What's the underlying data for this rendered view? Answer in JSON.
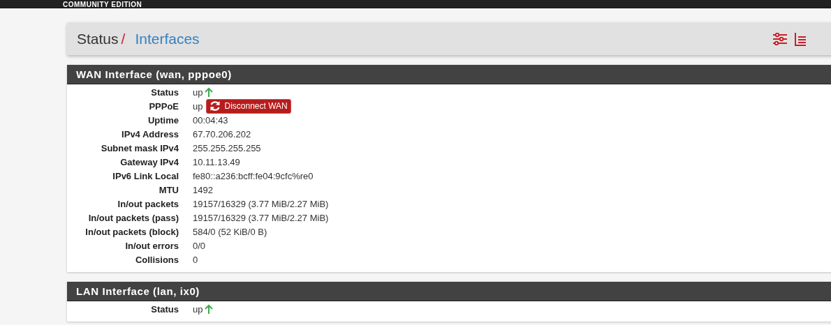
{
  "top_bar": {
    "edition": "COMMUNITY EDITION"
  },
  "breadcrumb": {
    "parent": "Status",
    "separator": "/",
    "current": "Interfaces"
  },
  "panels": [
    {
      "title": "WAN Interface (wan, pppoe0)",
      "rows": [
        {
          "label": "Status",
          "value": "up",
          "kind": "up"
        },
        {
          "label": "PPPoE",
          "value": "up",
          "kind": "action",
          "button": "Disconnect WAN"
        },
        {
          "label": "Uptime",
          "value": "00:04:43",
          "kind": "plain"
        },
        {
          "label": "IPv4 Address",
          "value": "67.70.206.202",
          "kind": "plain"
        },
        {
          "label": "Subnet mask IPv4",
          "value": "255.255.255.255",
          "kind": "plain"
        },
        {
          "label": "Gateway IPv4",
          "value": "10.11.13.49",
          "kind": "plain"
        },
        {
          "label": "IPv6 Link Local",
          "value": "fe80::a236:bcff:fe04:9cfc%re0",
          "kind": "plain"
        },
        {
          "label": "MTU",
          "value": "1492",
          "kind": "plain"
        },
        {
          "label": "In/out packets",
          "value": "19157/16329 (3.77 MiB/2.27 MiB)",
          "kind": "plain"
        },
        {
          "label": "In/out packets (pass)",
          "value": "19157/16329 (3.77 MiB/2.27 MiB)",
          "kind": "plain"
        },
        {
          "label": "In/out packets (block)",
          "value": "584/0 (52 KiB/0 B)",
          "kind": "plain"
        },
        {
          "label": "In/out errors",
          "value": "0/0",
          "kind": "plain"
        },
        {
          "label": "Collisions",
          "value": "0",
          "kind": "plain"
        }
      ]
    },
    {
      "title": "LAN Interface (lan, ix0)",
      "rows": [
        {
          "label": "Status",
          "value": "up",
          "kind": "up"
        }
      ]
    }
  ]
}
